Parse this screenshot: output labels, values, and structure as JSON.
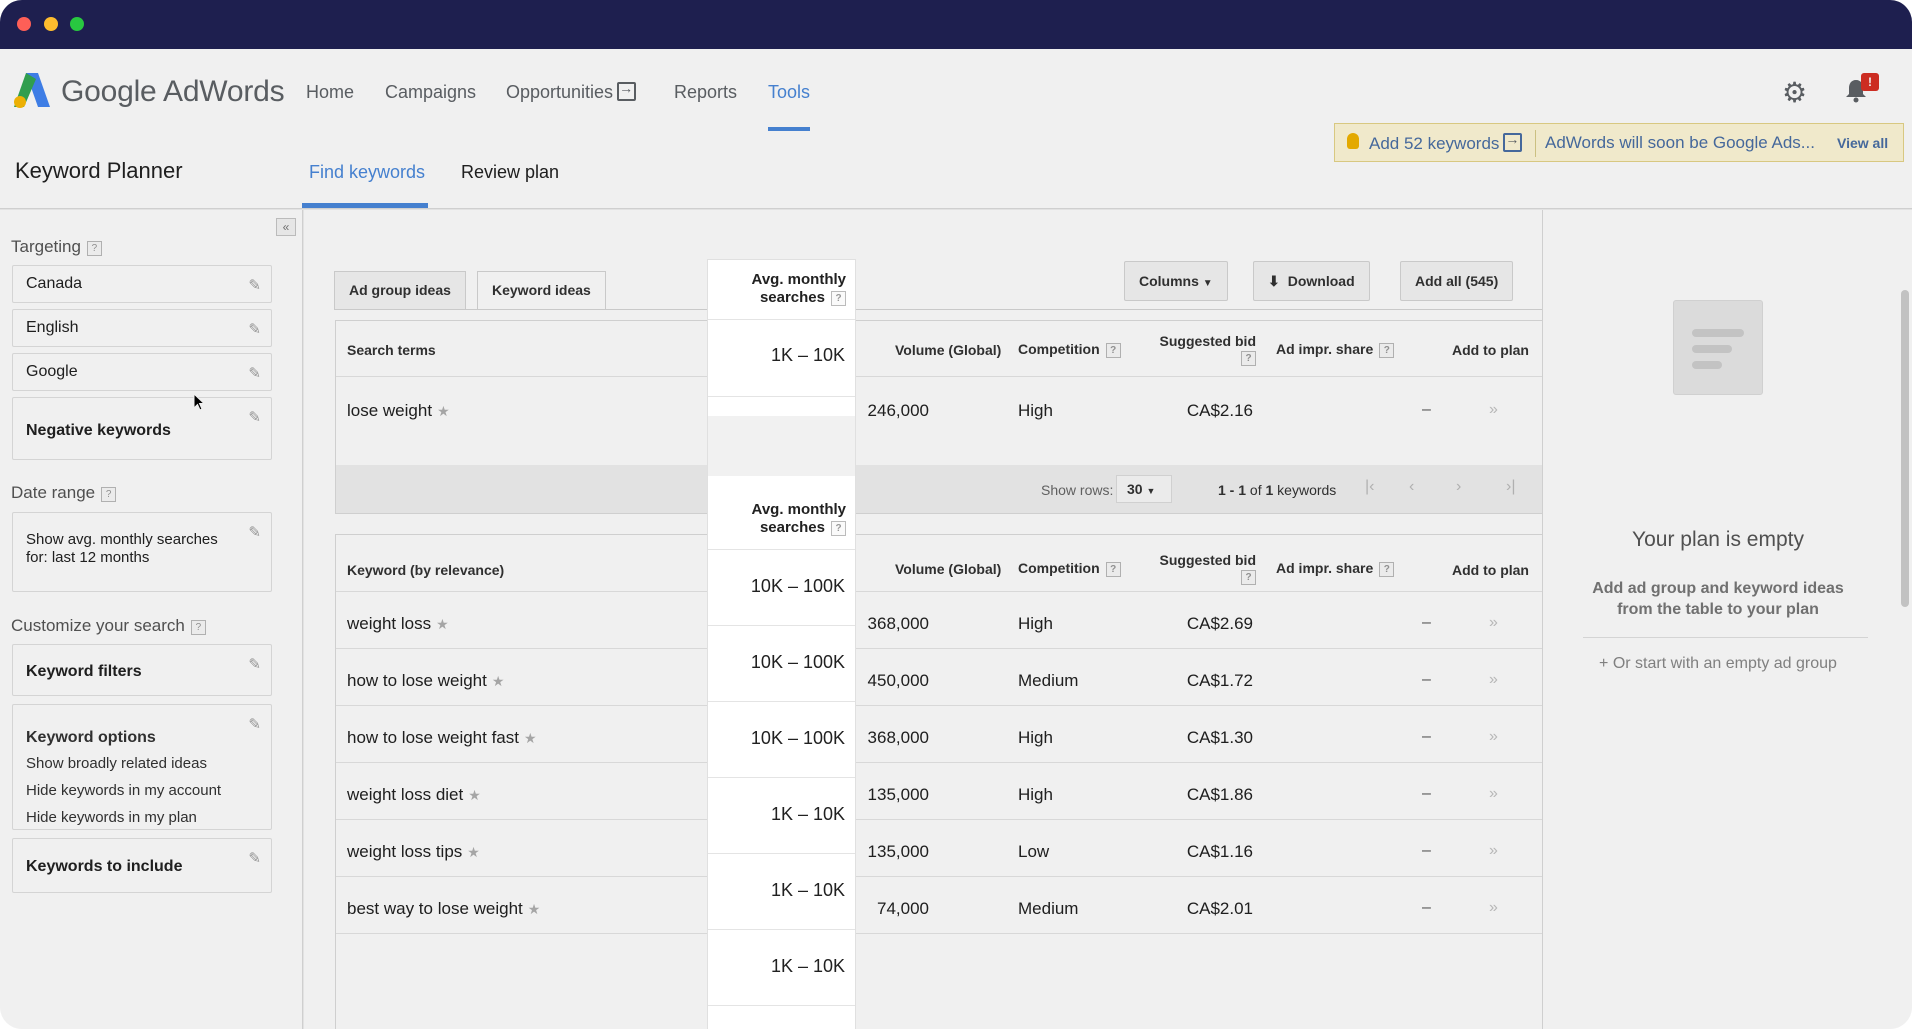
{
  "app": {
    "brand": "Google AdWords"
  },
  "nav": {
    "items": [
      "Home",
      "Campaigns",
      "Opportunities",
      "Reports",
      "Tools"
    ]
  },
  "notifications": {
    "count": "!"
  },
  "header": {
    "title": "Keyword Planner",
    "tabs": [
      "Find keywords",
      "Review plan"
    ]
  },
  "notice": {
    "keywords": "Add 52 keywords",
    "message": "AdWords will soon be Google Ads...",
    "view_all": "View all"
  },
  "sidebar": {
    "targeting_title": "Targeting",
    "targeting": [
      "Canada",
      "English",
      "Google",
      "Negative keywords"
    ],
    "date_range_title": "Date range",
    "date_range_line1": "Show avg. monthly searches",
    "date_range_line2": "for: last 12 months",
    "customize_title": "Customize your search",
    "keyword_filters": "Keyword filters",
    "keyword_options": {
      "title": "Keyword options",
      "lines": [
        "Show broadly related ideas",
        "Hide keywords in my account",
        "Hide keywords in my plan"
      ]
    },
    "keywords_to_include": "Keywords to include"
  },
  "toolbar": {
    "tab_ad_group": "Ad group ideas",
    "tab_keyword": "Keyword ideas",
    "columns": "Columns",
    "download": "Download",
    "add_all": "Add all (545)"
  },
  "search_table": {
    "headers": {
      "term": "Search terms",
      "avg_line1": "Avg. monthly",
      "avg_line2": "searches",
      "volume": "Volume (Global)",
      "competition": "Competition",
      "bid_line1": "Suggested bid",
      "impr": "Ad impr. share",
      "add": "Add to plan"
    },
    "rows": [
      {
        "term": "lose weight",
        "avg": "1K – 10K",
        "volume": "246,000",
        "competition": "High",
        "bid": "CA$2.16",
        "impr": "–"
      }
    ]
  },
  "pager": {
    "label": "Show rows:",
    "rows": "30",
    "range": "1 - 1",
    "of": "of",
    "total": "1",
    "unit": "keywords"
  },
  "idea_table": {
    "headers": {
      "term": "Keyword (by relevance)",
      "avg_line1": "Avg. monthly",
      "avg_line2": "searches",
      "volume": "Volume (Global)",
      "competition": "Competition",
      "bid_line1": "Suggested bid",
      "impr": "Ad impr. share",
      "add": "Add to plan"
    },
    "rows": [
      {
        "term": "weight loss",
        "avg": "10K – 100K",
        "volume": "368,000",
        "competition": "High",
        "bid": "CA$2.69",
        "impr": "–"
      },
      {
        "term": "how to lose weight",
        "avg": "10K – 100K",
        "volume": "450,000",
        "competition": "Medium",
        "bid": "CA$1.72",
        "impr": "–"
      },
      {
        "term": "how to lose weight fast",
        "avg": "10K – 100K",
        "volume": "368,000",
        "competition": "High",
        "bid": "CA$1.30",
        "impr": "–"
      },
      {
        "term": "weight loss diet",
        "avg": "1K – 10K",
        "volume": "135,000",
        "competition": "High",
        "bid": "CA$1.86",
        "impr": "–"
      },
      {
        "term": "weight loss tips",
        "avg": "1K – 10K",
        "volume": "135,000",
        "competition": "Low",
        "bid": "CA$1.16",
        "impr": "–"
      },
      {
        "term": "best way to lose weight",
        "avg": "1K – 10K",
        "volume": "74,000",
        "competition": "Medium",
        "bid": "CA$2.01",
        "impr": "–"
      }
    ]
  },
  "plan": {
    "title": "Your plan is empty",
    "sub_line1": "Add ad group and keyword ideas",
    "sub_line2": "from the table to your plan",
    "link": "+ Or start with an empty ad group"
  }
}
